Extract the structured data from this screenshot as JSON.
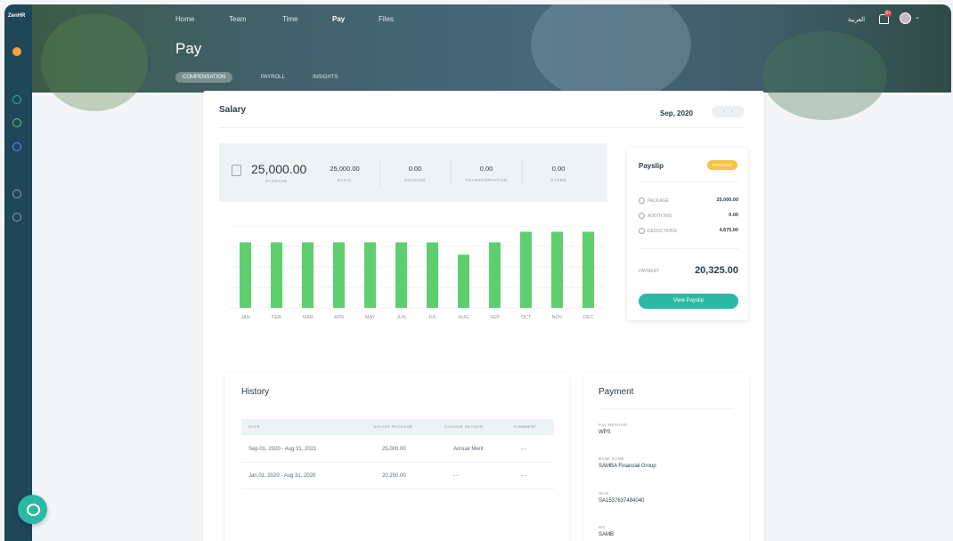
{
  "app": {
    "logo": "ZenHR"
  },
  "topnav": {
    "items": [
      "Home",
      "Team",
      "Time",
      "Pay",
      "Files"
    ],
    "active": "Pay",
    "language": "العربية",
    "notification_count": "9+"
  },
  "page": {
    "title": "Pay",
    "tabs": [
      "COMPENSATION",
      "PAYROLL",
      "INSIGHTS"
    ],
    "active_tab": "COMPENSATION"
  },
  "salary": {
    "title": "Salary",
    "period": "Sep, 2020",
    "package": {
      "value": "25,000.00",
      "label": "PACKAGE"
    },
    "breakdown": [
      {
        "value": "25,000.00",
        "label": "BASIC"
      },
      {
        "value": "0.00",
        "label": "HOUSING"
      },
      {
        "value": "0.00",
        "label": "TRANSPORTATION"
      },
      {
        "value": "0.00",
        "label": "OTHER"
      }
    ]
  },
  "chart_data": {
    "type": "bar",
    "categories": [
      "JAN",
      "FEB",
      "MAR",
      "APR",
      "MAY",
      "JUN",
      "JUL",
      "AUG",
      "SEP",
      "OCT",
      "NOV",
      "DEC"
    ],
    "values": [
      0.8,
      0.8,
      0.8,
      0.8,
      0.8,
      0.8,
      0.8,
      0.65,
      0.8,
      0.93,
      0.93,
      0.93
    ],
    "color": "#5fcf6e",
    "grid": true
  },
  "payslip": {
    "title": "Payslip",
    "status": "PENDING",
    "rows": [
      {
        "label": "PACKAGE",
        "value": "25,000.00"
      },
      {
        "label": "ADDITIONS",
        "value": "0.00"
      },
      {
        "label": "DEDUCTIONS",
        "value": "4,675.00"
      }
    ],
    "payment_label": "PAYMENT",
    "payment_value": "20,325.00",
    "button": "View Payslip"
  },
  "history": {
    "title": "History",
    "columns": [
      "DATE",
      "SALARY PACKAGE",
      "CHANGE REASON",
      "COMMENT"
    ],
    "rows": [
      {
        "date": "Sep 01, 2020 - Aug 31, 2021",
        "package": "25,000.00",
        "reason": "Annual Merit",
        "comment": "- -"
      },
      {
        "date": "Jan 01, 2020 - Aug 31, 2020",
        "package": "20,250.00",
        "reason": "- -",
        "comment": "- -"
      }
    ]
  },
  "payment": {
    "title": "Payment",
    "items": [
      {
        "label": "PAY METHOD",
        "value": "WPS"
      },
      {
        "label": "BANK NAME",
        "value": "SAMBA Financial Group"
      },
      {
        "label": "IBAN",
        "value": "SA1537637484040"
      },
      {
        "label": "BIC",
        "value": "SAMB"
      }
    ]
  },
  "colors": {
    "sidebar": "#20465a",
    "accent": "#2bb8a4",
    "bar": "#5fcf6e",
    "pending": "#f6c445"
  }
}
